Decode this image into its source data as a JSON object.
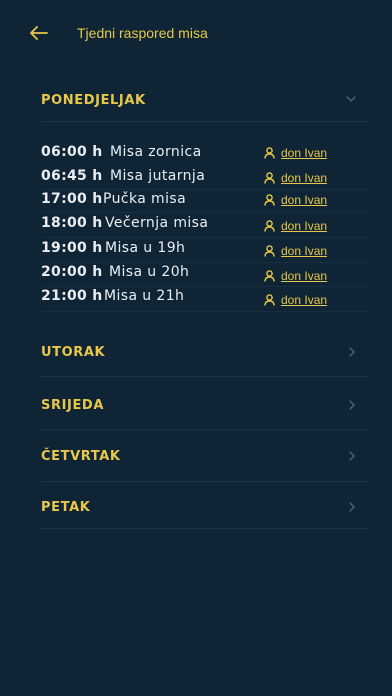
{
  "header": {
    "title": "Tjedni raspored misa"
  },
  "colors": {
    "background": "#0f2535",
    "accent": "#e8c74a",
    "text": "#e9eef2"
  },
  "days": [
    {
      "label": "PONEDJELJAK",
      "expanded": true,
      "icon": "chevron-down-icon"
    },
    {
      "label": "UTORAK",
      "expanded": false,
      "icon": "chevron-right-icon"
    },
    {
      "label": "SRIJEDA",
      "expanded": false,
      "icon": "chevron-right-icon"
    },
    {
      "label": "ČETVRTAK",
      "expanded": false,
      "icon": "chevron-right-icon"
    },
    {
      "label": "PETAK",
      "expanded": false,
      "icon": "chevron-right-icon"
    }
  ],
  "masses": [
    {
      "time": "06:00 h",
      "name": "Misa zornica",
      "priest": "don Ivan"
    },
    {
      "time": "06:45 h",
      "name": "Misa jutarnja",
      "priest": "don Ivan"
    },
    {
      "time": "17:00 h",
      "name": "Pučka misa",
      "priest": "don Ivan"
    },
    {
      "time": "18:00 h",
      "name": "Večernja misa",
      "priest": "don Ivan"
    },
    {
      "time": "19:00 h",
      "name": "Misa u 19h",
      "priest": "don Ivan"
    },
    {
      "time": "20:00 h",
      "name": "Misa u 20h",
      "priest": "don Ivan"
    },
    {
      "time": "21:00 h",
      "name": "Misa u 21h",
      "priest": "don Ivan"
    }
  ]
}
